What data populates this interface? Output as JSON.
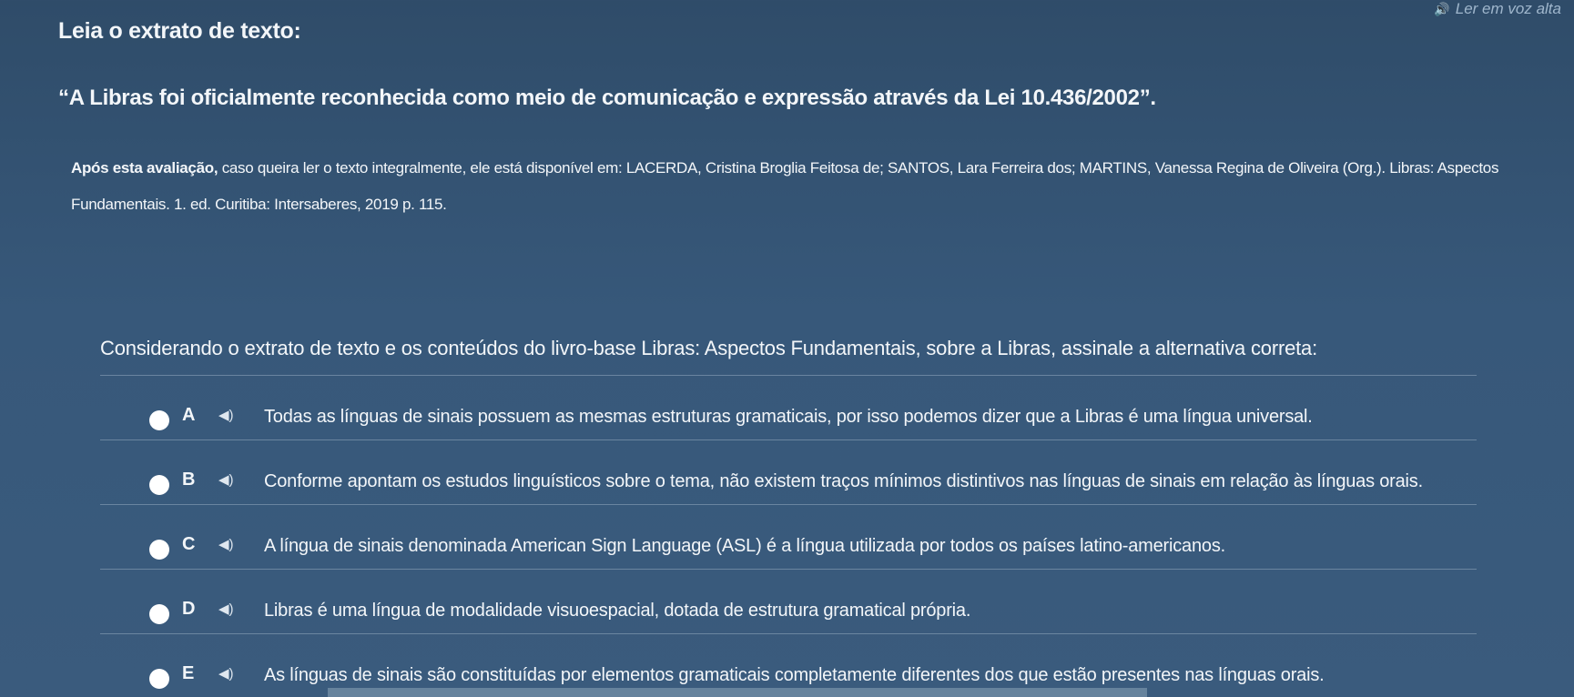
{
  "read_aloud_label": "Ler em voz alta",
  "title": "Leia o extrato de texto:",
  "quote": "“A Libras foi oficialmente reconhecida como meio de comunicação e expressão através da Lei 10.436/2002”.",
  "source_lead": "Após esta avaliação,",
  "source_rest": " caso queira ler o texto integralmente, ele está disponível em: LACERDA, Cristina Broglia Feitosa de; SANTOS, Lara Ferreira dos; MARTINS, Vanessa Regina de Oliveira (Org.). Libras: Aspectos Fundamentais. 1. ed. Curitiba: Intersaberes, 2019 p. 115.",
  "question": "Considerando o extrato de texto e os conteúdos do livro-base Libras: Aspectos Fundamentais, sobre a Libras, assinale a alternativa correta:",
  "options": [
    {
      "letter": "A",
      "text": "Todas as línguas de sinais possuem as mesmas estruturas gramaticais, por isso podemos dizer que a Libras é uma língua universal."
    },
    {
      "letter": "B",
      "text": "Conforme apontam os estudos linguísticos sobre o tema, não existem traços mínimos distintivos nas línguas de sinais em relação às línguas orais."
    },
    {
      "letter": "C",
      "text": "A língua de sinais denominada American Sign Language (ASL) é a língua utilizada por todos os países latino-americanos."
    },
    {
      "letter": "D",
      "text": "Libras é uma língua de modalidade visuoespacial, dotada de estrutura gramatical própria."
    },
    {
      "letter": "E",
      "text": "As línguas de sinais são constituídas por elementos gramaticais completamente diferentes dos que estão presentes nas línguas orais."
    }
  ]
}
